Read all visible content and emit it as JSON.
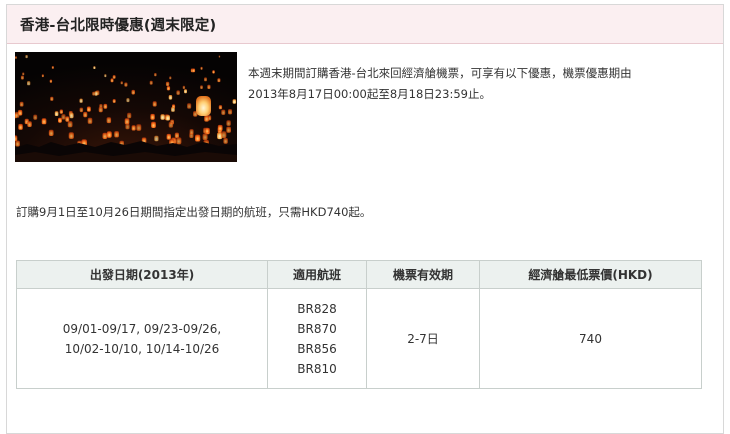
{
  "panel": {
    "title": "香港-台北限時優惠(週末限定)"
  },
  "intro": {
    "line1": "本週末期間訂購香港-台北來回經濟艙機票，可享有以下優惠，機票優惠期由",
    "line2": "2013年8月17日00:00起至8月18日23:59止。"
  },
  "offer": {
    "text": "訂購9月1日至10月26日期間指定出發日期的航班，只需HKD740起。"
  },
  "table": {
    "headers": [
      "出發日期(2013年)",
      "適用航班",
      "機票有效期",
      "經濟艙最低票價(HKD)"
    ],
    "row": {
      "dates": [
        "09/01-09/17, 09/23-09/26,",
        "10/02-10/10, 10/14-10/26"
      ],
      "flights": [
        "BR828",
        "BR870",
        "BR856",
        "BR810"
      ],
      "validity": "2-7日",
      "price": "740"
    }
  },
  "colors": {
    "header_bg": "#fbeff1",
    "table_header_bg": "#ecf1ef",
    "border": "#c8cfcc"
  }
}
